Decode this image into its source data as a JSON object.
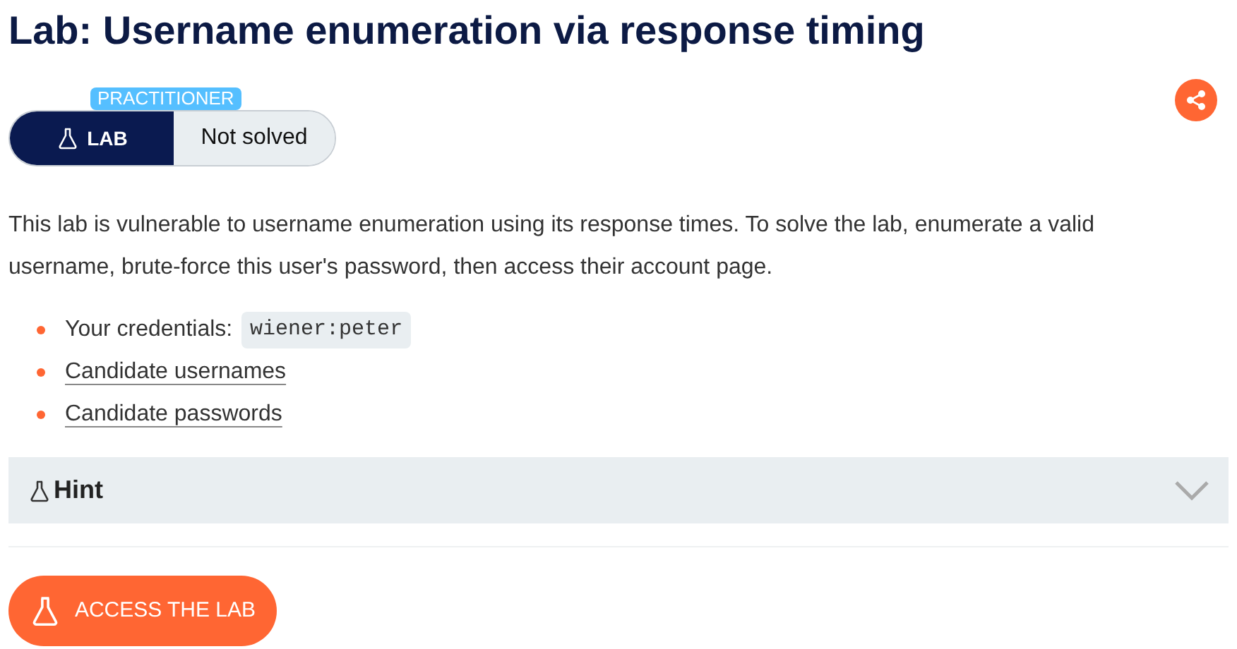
{
  "title": "Lab: Username enumeration via response timing",
  "badge": {
    "level": "PRACTITIONER",
    "type": "LAB",
    "status": "Not solved"
  },
  "description": "This lab is vulnerable to username enumeration using its response times. To solve the lab, enumerate a valid username, brute-force this user's password, then access their account page.",
  "items": [
    {
      "kind": "code",
      "label": "Your credentials: ",
      "code": "wiener:peter"
    },
    {
      "kind": "link",
      "label": "Candidate usernames"
    },
    {
      "kind": "link",
      "label": "Candidate passwords"
    }
  ],
  "hint": {
    "label": "Hint",
    "expanded": false
  },
  "button": "ACCESS THE LAB"
}
